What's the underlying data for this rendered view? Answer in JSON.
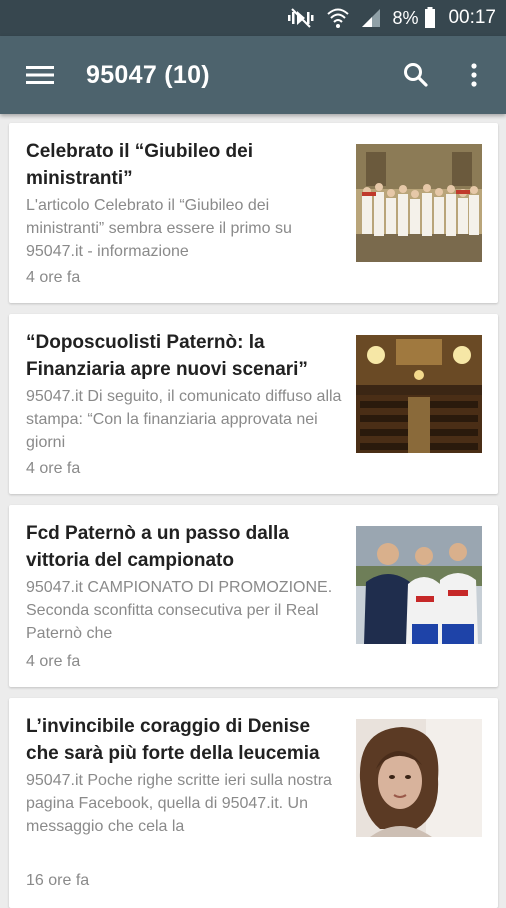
{
  "status_bar": {
    "battery": "8%",
    "time": "00:17",
    "icons": [
      "mute-icon",
      "wifi-icon",
      "signal-icon",
      "battery-icon"
    ]
  },
  "app_bar": {
    "title": "95047 (10)",
    "icons": [
      "menu-icon",
      "search-icon",
      "more-vert-icon"
    ]
  },
  "articles": [
    {
      "headline": "Celebrato il “Giubileo dei ministranti”",
      "snippet": "L'articolo Celebrato il “Giubileo dei ministranti” sembra essere il primo su 95047.it - informazione",
      "time": "4 ore fa",
      "image": "altar-servers-group-photo"
    },
    {
      "headline": "“Doposcuolisti Paternò: la Finanziaria apre nuovi scenari”",
      "snippet": "95047.it Di seguito, il comunicato diffuso alla stampa: “Con la finanziaria approvata nei giorni",
      "time": "4 ore fa",
      "image": "council-chamber-photo"
    },
    {
      "headline": "Fcd Paternò a un passo dalla vittoria del campionato",
      "snippet": "95047.it CAMPIONATO DI PROMOZIONE. Seconda sconfitta consecutiva per il Real Paternò che",
      "time": "4 ore fa",
      "image": "football-team-photo"
    },
    {
      "headline": "L’invincibile coraggio di Denise che sarà più forte della leucemia",
      "snippet": "95047.it Poche righe scritte ieri sulla nostra pagina Facebook, quella di 95047.it. Un messaggio che cela la",
      "time": "16 ore fa",
      "image": "portrait-photo"
    }
  ],
  "colors": {
    "status_bar": "#37474f",
    "app_bar": "#4d636d",
    "background": "#ececec",
    "headline": "#212121",
    "secondary_text": "#8a8a8a"
  }
}
